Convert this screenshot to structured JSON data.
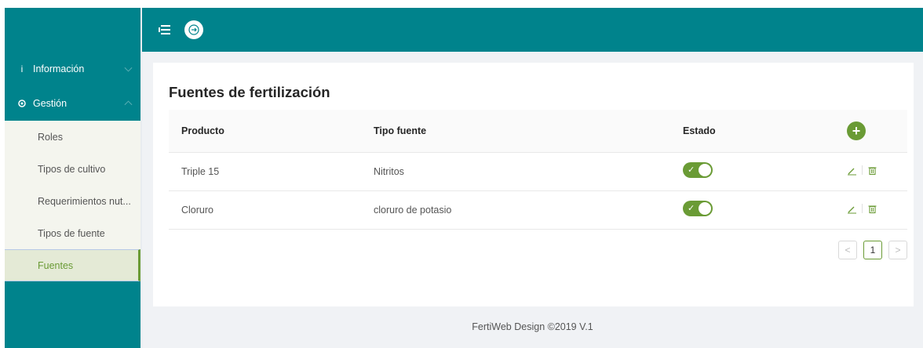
{
  "sidebar": {
    "groups": [
      {
        "icon": "info-icon",
        "label": "Información"
      },
      {
        "icon": "gear-icon",
        "label": "Gestión"
      }
    ],
    "submenu": [
      {
        "label": "Roles",
        "active": false
      },
      {
        "label": "Tipos de cultivo",
        "active": false
      },
      {
        "label": "Requerimientos nut...",
        "active": false
      },
      {
        "label": "Tipos de fuente",
        "active": false
      },
      {
        "label": "Fuentes",
        "active": true
      }
    ]
  },
  "topbar": {
    "menu_icon": "menu-fold-icon",
    "logout_icon": "logout-icon"
  },
  "page": {
    "title": "Fuentes de fertilización"
  },
  "table": {
    "columns": [
      "Producto",
      "Tipo fuente",
      "Estado"
    ],
    "rows": [
      {
        "producto": "Triple 15",
        "tipo_fuente": "Nitritos",
        "estado": true
      },
      {
        "producto": "Cloruro",
        "tipo_fuente": "cloruro de potasio",
        "estado": true
      }
    ]
  },
  "pagination": {
    "prev": "<",
    "current": "1",
    "next": ">"
  },
  "footer": {
    "text": "FertiWeb Design ©2019 V.1"
  },
  "colors": {
    "teal": "#00838c",
    "green": "#6a9b35",
    "background": "#f0f2f5"
  }
}
